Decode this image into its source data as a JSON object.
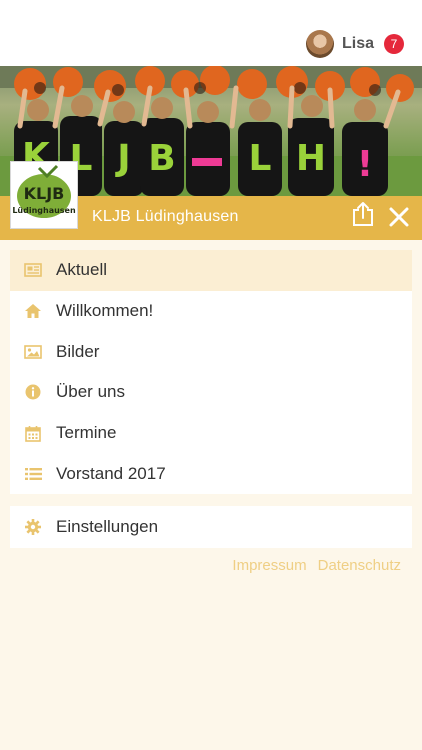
{
  "user": {
    "name": "Lisa",
    "badge_count": "7"
  },
  "header": {
    "title": "KLJB Lüdinghausen"
  },
  "logo": {
    "main_text": "KLJB",
    "sub_text": "Lüdinghausen"
  },
  "hero": {
    "shirt_letters": [
      "K",
      "L",
      "J",
      "B",
      "L",
      "H",
      "!"
    ]
  },
  "menu": {
    "items": [
      {
        "label": "Aktuell",
        "icon": "newspaper-icon",
        "active": true
      },
      {
        "label": "Willkommen!",
        "icon": "home-icon"
      },
      {
        "label": "Bilder",
        "icon": "image-icon"
      },
      {
        "label": "Über uns",
        "icon": "info-icon"
      },
      {
        "label": "Termine",
        "icon": "calendar-icon"
      },
      {
        "label": "Vorstand 2017",
        "icon": "list-icon"
      }
    ],
    "settings": {
      "label": "Einstellungen",
      "icon": "gear-icon"
    }
  },
  "footer": {
    "impressum": "Impressum",
    "datenschutz": "Datenschutz"
  },
  "colors": {
    "accent": "#e5b649",
    "icon": "#e9c46e",
    "active_row": "#fbeed3",
    "badge": "#e5283b",
    "link": "#efcf85"
  }
}
